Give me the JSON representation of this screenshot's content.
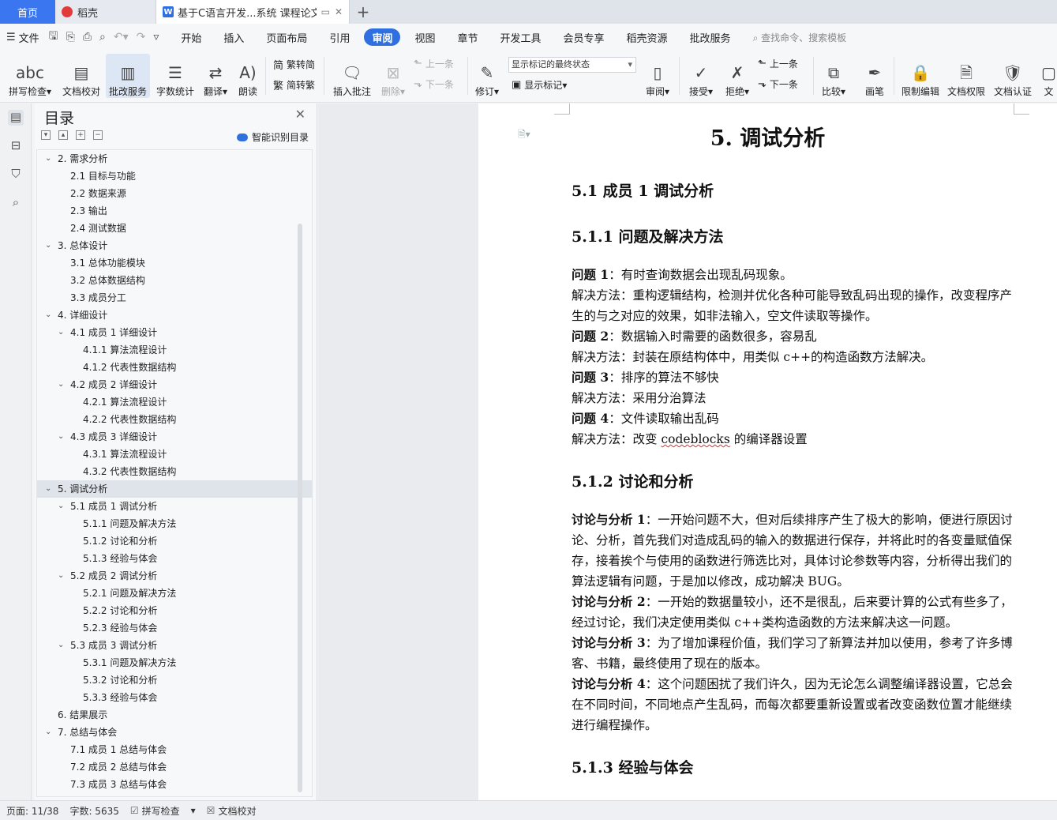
{
  "tabs": {
    "home": "首页",
    "docer": "稻壳",
    "document": "基于C语言开发...系统 课程论文"
  },
  "menu": {
    "file": "文件",
    "items": [
      "开始",
      "插入",
      "页面布局",
      "引用",
      "审阅",
      "视图",
      "章节",
      "开发工具",
      "会员专享",
      "稻壳资源",
      "批改服务"
    ],
    "active_index": 4,
    "search_placeholder": "查找命令、搜索模板"
  },
  "ribbon": {
    "spell_check": "拼写检查",
    "doc_proof": "文档校对",
    "review_service": "批改服务",
    "word_count": "字数统计",
    "translate": "翻译",
    "read_aloud": "朗读",
    "to_traditional": "繁转简",
    "to_simplified": "简转繁",
    "insert_comment": "插入批注",
    "delete": "删除",
    "prev": "上一条",
    "next": "下一条",
    "track_changes": "修订",
    "markup_select": "显示标记的最终状态",
    "show_markup": "显示标记",
    "review": "审阅",
    "accept": "接受",
    "reject": "拒绝",
    "prev2": "上一条",
    "next2": "下一条",
    "compare": "比较",
    "pen": "画笔",
    "restrict_edit": "限制编辑",
    "doc_permission": "文档权限",
    "doc_certify": "文档认证",
    "doc_more": "文"
  },
  "toc": {
    "title": "目录",
    "smart_label": "智能识别目录",
    "items": [
      {
        "text": "2.  需求分析",
        "level": 1,
        "caret": "down"
      },
      {
        "text": "2.1  目标与功能",
        "level": 2,
        "caret": ""
      },
      {
        "text": "2.2  数据来源",
        "level": 2,
        "caret": ""
      },
      {
        "text": "2.3  输出",
        "level": 2,
        "caret": ""
      },
      {
        "text": "2.4 测试数据",
        "level": 2,
        "caret": ""
      },
      {
        "text": "3.  总体设计",
        "level": 1,
        "caret": "down"
      },
      {
        "text": "3.1  总体功能模块",
        "level": 2,
        "caret": ""
      },
      {
        "text": "3.2  总体数据结构",
        "level": 2,
        "caret": ""
      },
      {
        "text": "3.3  成员分工",
        "level": 2,
        "caret": ""
      },
      {
        "text": "4.  详细设计",
        "level": 1,
        "caret": "down"
      },
      {
        "text": "4.1  成员 1 详细设计",
        "level": 2,
        "caret": "down"
      },
      {
        "text": "4.1.1  算法流程设计",
        "level": 3,
        "caret": ""
      },
      {
        "text": "4.1.2  代表性数据结构",
        "level": 3,
        "caret": ""
      },
      {
        "text": "4.2  成员 2 详细设计",
        "level": 2,
        "caret": "down"
      },
      {
        "text": "4.2.1  算法流程设计",
        "level": 3,
        "caret": ""
      },
      {
        "text": "4.2.2  代表性数据结构",
        "level": 3,
        "caret": ""
      },
      {
        "text": "4.3  成员 3 详细设计",
        "level": 2,
        "caret": "down"
      },
      {
        "text": "4.3.1  算法流程设计",
        "level": 3,
        "caret": ""
      },
      {
        "text": "4.3.2  代表性数据结构",
        "level": 3,
        "caret": ""
      },
      {
        "text": "5.  调试分析",
        "level": 1,
        "caret": "down",
        "active": true
      },
      {
        "text": "5.1  成员 1 调试分析",
        "level": 2,
        "caret": "down"
      },
      {
        "text": "5.1.1  问题及解决方法",
        "level": 3,
        "caret": ""
      },
      {
        "text": "5.1.2  讨论和分析",
        "level": 3,
        "caret": ""
      },
      {
        "text": "5.1.3  经验与体会",
        "level": 3,
        "caret": ""
      },
      {
        "text": "5.2  成员 2 调试分析",
        "level": 2,
        "caret": "down"
      },
      {
        "text": "5.2.1  问题及解决方法",
        "level": 3,
        "caret": ""
      },
      {
        "text": "5.2.2  讨论和分析",
        "level": 3,
        "caret": ""
      },
      {
        "text": "5.2.3  经验与体会",
        "level": 3,
        "caret": ""
      },
      {
        "text": "5.3  成员 3 调试分析",
        "level": 2,
        "caret": "down"
      },
      {
        "text": "5.3.1  问题及解决方法",
        "level": 3,
        "caret": ""
      },
      {
        "text": "5.3.2  讨论和分析",
        "level": 3,
        "caret": ""
      },
      {
        "text": "5.3.3  经验与体会",
        "level": 3,
        "caret": ""
      },
      {
        "text": "6.  结果展示",
        "level": 1,
        "caret": ""
      },
      {
        "text": "7.  总结与体会",
        "level": 1,
        "caret": "down"
      },
      {
        "text": "7.1  成员 1 总结与体会",
        "level": 2,
        "caret": ""
      },
      {
        "text": "7.2  成员 2 总结与体会",
        "level": 2,
        "caret": ""
      },
      {
        "text": "7.3  成员 3 总结与体会",
        "level": 2,
        "caret": ""
      }
    ]
  },
  "doc": {
    "h1": "5.  调试分析",
    "h2_51": "5.1  成员 1 调试分析",
    "h3_511": "5.1.1  问题及解决方法",
    "q1_label": "问题 1",
    "q1_text": "：有时查询数据会出现乱码现象。",
    "a1": "解决方法：重构逻辑结构，检测并优化各种可能导致乱码出现的操作，改变程序产生的与之对应的效果，如非法输入，空文件读取等操作。",
    "q2_label": "问题 2",
    "q2_text": "：数据输入时需要的函数很多，容易乱",
    "a2": "解决方法：封装在原结构体中，用类似 c++的构造函数方法解决。",
    "q3_label": "问题 3",
    "q3_text": "：排序的算法不够快",
    "a3": "解决方法：采用分治算法",
    "q4_label": "问题 4",
    "q4_text": "：文件读取输出乱码",
    "a4_pre": "解决方法：改变 ",
    "a4_word": "codeblocks",
    "a4_post": " 的编译器设置",
    "h3_512": "5.1.2  讨论和分析",
    "d1_label": "讨论与分析 1",
    "d1_text": "：一开始问题不大，但对后续排序产生了极大的影响，便进行原因讨论、分析，首先我们对造成乱码的输入的数据进行保存，并将此时的各变量赋值保存，接着挨个与使用的函数进行筛选比对，具体讨论参数等内容，分析得出我们的算法逻辑有问题，于是加以修改，成功解决 BUG。",
    "d2_label": "讨论与分析 2",
    "d2_text": "：一开始的数据量较小，还不是很乱，后来要计算的公式有些多了，经过讨论，我们决定使用类似 c++类构造函数的方法来解决这一问题。",
    "d3_label": "讨论与分析 3",
    "d3_text": "：为了增加课程价值，我们学习了新算法并加以使用，参考了许多博客、书籍，最终使用了现在的版本。",
    "d4_label": "讨论与分析 4",
    "d4_text": "：这个问题困扰了我们许久，因为无论怎么调整编译器设置，它总会在不同时间，不同地点产生乱码，而每次都要重新设置或者改变函数位置才能继续进行编程操作。",
    "h3_513": "5.1.3  经验与体会"
  },
  "status": {
    "page": "页面: 11/38",
    "words": "字数: 5635",
    "spell": "拼写检查",
    "proof": "文档校对"
  }
}
